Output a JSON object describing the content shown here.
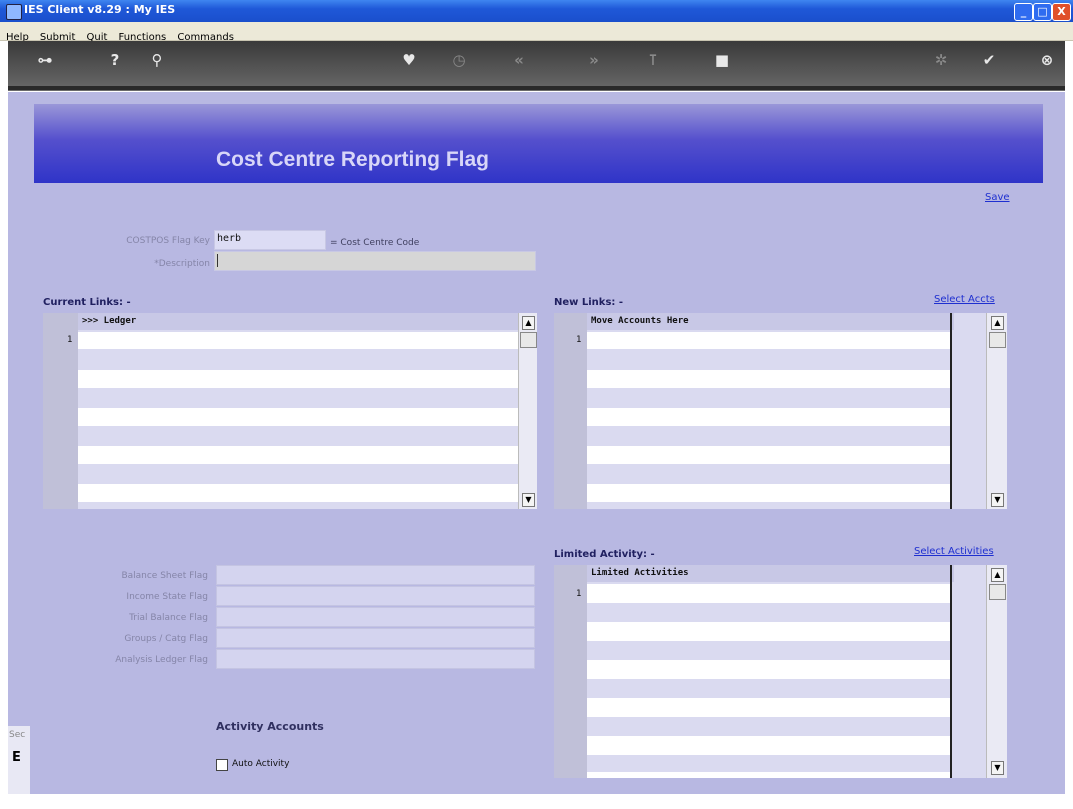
{
  "window": {
    "title": "IES Client v8.29 : My IES",
    "min_label": "_",
    "max_label": "□",
    "close_label": "X"
  },
  "menu": [
    "Help",
    "Submit",
    "Quit",
    "Functions",
    "Commands"
  ],
  "toolbar": {
    "icons": [
      "key-icon",
      "help-icon",
      "search-icon",
      "heart-icon",
      "clock-icon",
      "rewind-icon",
      "fast-forward-icon",
      "pin-icon",
      "stop-icon",
      "refresh-icon",
      "check-icon",
      "close-icon"
    ]
  },
  "page": {
    "title": "Cost Centre Reporting Flag",
    "save_link": "Save"
  },
  "form": {
    "key_label": "COSTPOS Flag Key",
    "key_value": "herb",
    "key_hint": "= Cost Centre Code",
    "description_label": "*Description",
    "description_value": ""
  },
  "current_links": {
    "title": "Current Links: -",
    "header": ">>> Ledger",
    "first_row_number": "1"
  },
  "new_links": {
    "title": "New Links: -",
    "select_link": "Select Accts",
    "header": "Move Accounts Here",
    "first_row_number": "1"
  },
  "flags": {
    "balance_sheet": "Balance Sheet Flag",
    "income_state": "Income State Flag",
    "trial_balance": "Trial Balance Flag",
    "groups_catg": "Groups / Catg Flag",
    "analysis_ledger": "Analysis Ledger Flag"
  },
  "limited_activity": {
    "title": "Limited Activity: -",
    "select_link": "Select Activities",
    "header": "Limited Activities",
    "first_row_number": "1"
  },
  "activity_accounts": {
    "title": "Activity Accounts",
    "auto_activity_label": "Auto Activity",
    "auto_activity_checked": false
  },
  "side_fragment": {
    "text1": "Sec",
    "text2": "E"
  },
  "scroll": {
    "up": "▲",
    "down": "▼"
  }
}
